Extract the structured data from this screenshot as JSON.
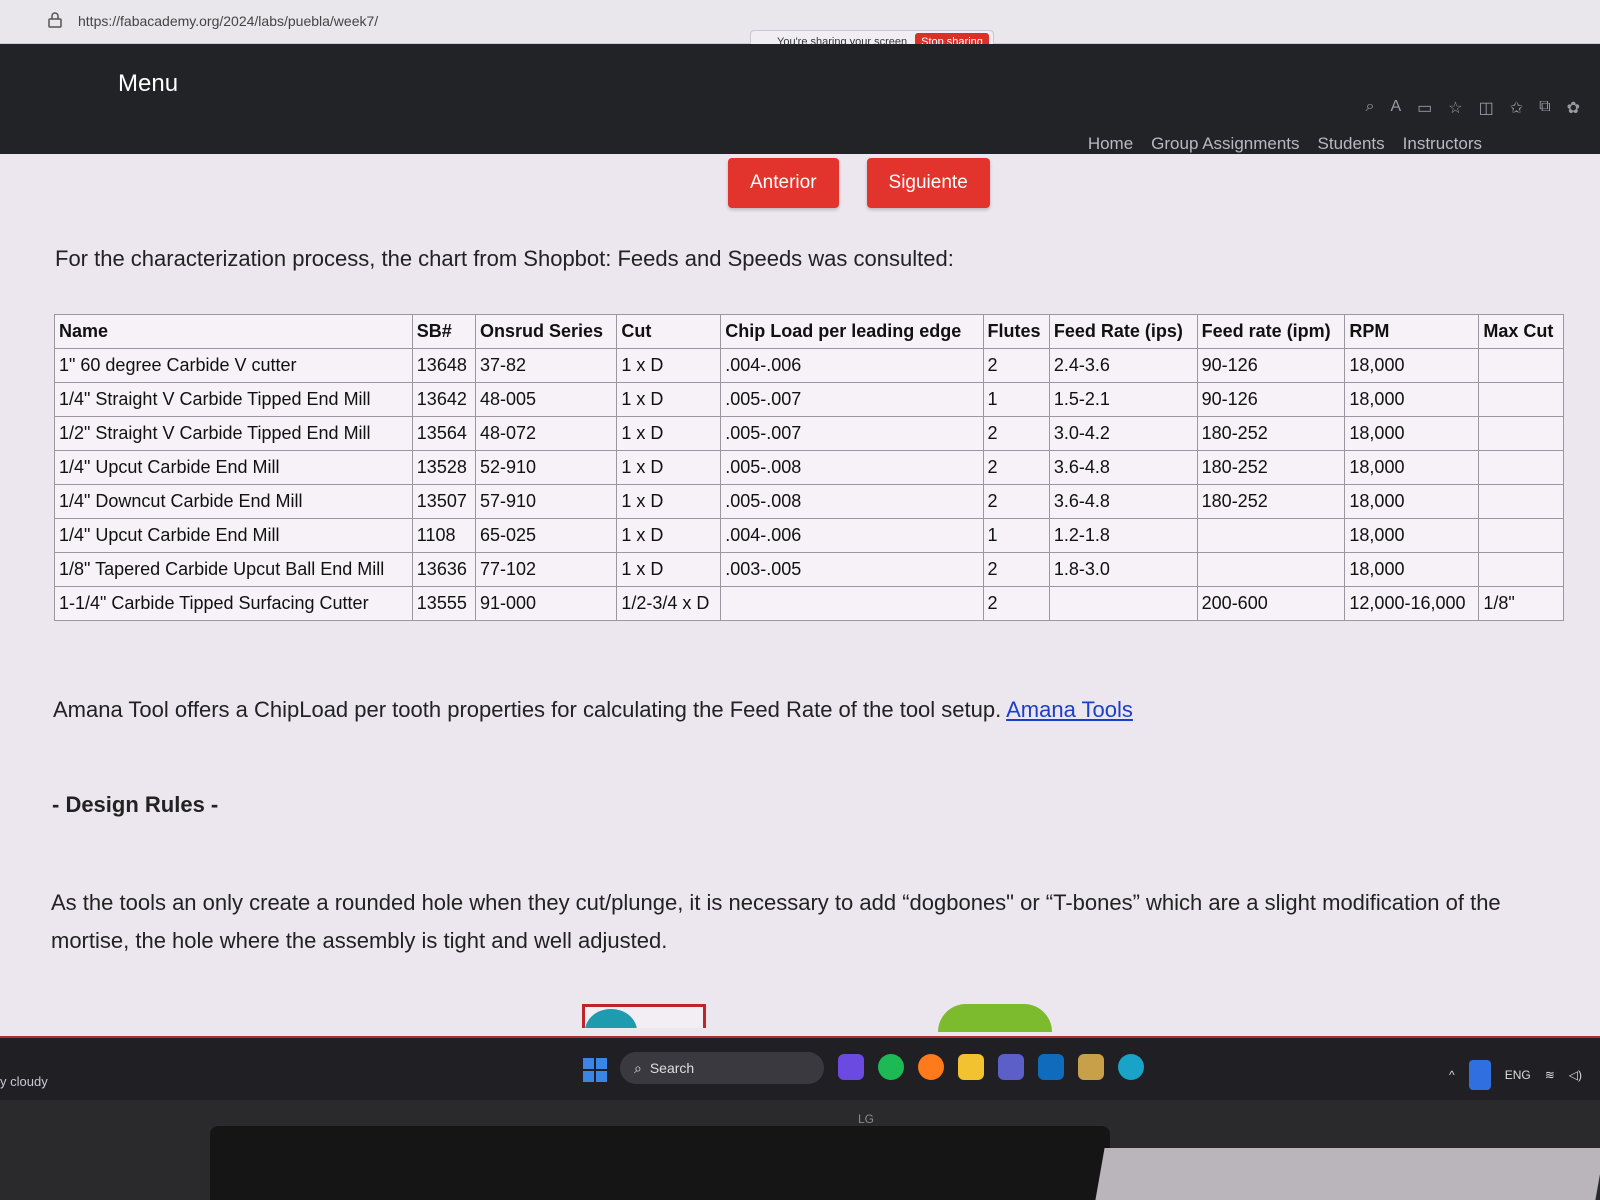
{
  "browser": {
    "url": "https://fabacademy.org/2024/labs/puebla/week7/",
    "sharing_text": "You're sharing your screen",
    "stop_sharing": "Stop sharing"
  },
  "site": {
    "menu": "Menu",
    "nav": [
      "Home",
      "Group Assignments",
      "Students",
      "Instructors"
    ]
  },
  "pager": {
    "prev": "Anterior",
    "next": "Siguiente"
  },
  "intro": "For the characterization process, the chart from Shopbot: Feeds and Speeds was consulted:",
  "table": {
    "headers": [
      "Name",
      "SB#",
      "Onsrud Series",
      "Cut",
      "Chip Load per leading edge",
      "Flutes",
      "Feed Rate (ips)",
      "Feed rate (ipm)",
      "RPM",
      "Max Cut"
    ],
    "rows": [
      [
        "1\" 60 degree Carbide V cutter",
        "13648",
        "37-82",
        "1 x D",
        ".004-.006",
        "2",
        "2.4-3.6",
        "90-126",
        "18,000",
        ""
      ],
      [
        "1/4\" Straight V Carbide Tipped End Mill",
        "13642",
        "48-005",
        "1 x D",
        ".005-.007",
        "1",
        "1.5-2.1",
        "90-126",
        "18,000",
        ""
      ],
      [
        "1/2\" Straight V Carbide Tipped End Mill",
        "13564",
        "48-072",
        "1 x D",
        ".005-.007",
        "2",
        "3.0-4.2",
        "180-252",
        "18,000",
        ""
      ],
      [
        "1/4\" Upcut Carbide End Mill",
        "13528",
        "52-910",
        "1 x D",
        ".005-.008",
        "2",
        "3.6-4.8",
        "180-252",
        "18,000",
        ""
      ],
      [
        "1/4\" Downcut Carbide End Mill",
        "13507",
        "57-910",
        "1 x D",
        ".005-.008",
        "2",
        "3.6-4.8",
        "180-252",
        "18,000",
        ""
      ],
      [
        "1/4\" Upcut Carbide End Mill",
        "1108",
        "65-025",
        "1 x D",
        ".004-.006",
        "1",
        "1.2-1.8",
        "",
        "18,000",
        ""
      ],
      [
        "1/8\" Tapered Carbide Upcut Ball End Mill",
        "13636",
        "77-102",
        "1 x D",
        ".003-.005",
        "2",
        "1.8-3.0",
        "",
        "18,000",
        ""
      ],
      [
        "1-1/4\" Carbide Tipped Surfacing Cutter",
        "13555",
        "91-000",
        "1/2-3/4 x D",
        "",
        "2",
        "",
        "200-600",
        "12,000-16,000",
        "1/8\""
      ]
    ]
  },
  "amana": {
    "text": "Amana Tool offers a ChipLoad per tooth properties for calculating the Feed Rate of the tool setup. ",
    "link": "Amana Tools"
  },
  "design_rules": {
    "heading": "- Design Rules -",
    "paragraph": "As the tools an only create a rounded hole when they cut/plunge, it is necessary to add “dogbones\" or “T-bones” which are a slight modification of the mortise, the hole where the assembly is tight and well adjusted."
  },
  "taskbar": {
    "weather": "y cloudy",
    "search_placeholder": "Search",
    "lang": "ENG"
  },
  "monitor": {
    "brand": "LG"
  }
}
